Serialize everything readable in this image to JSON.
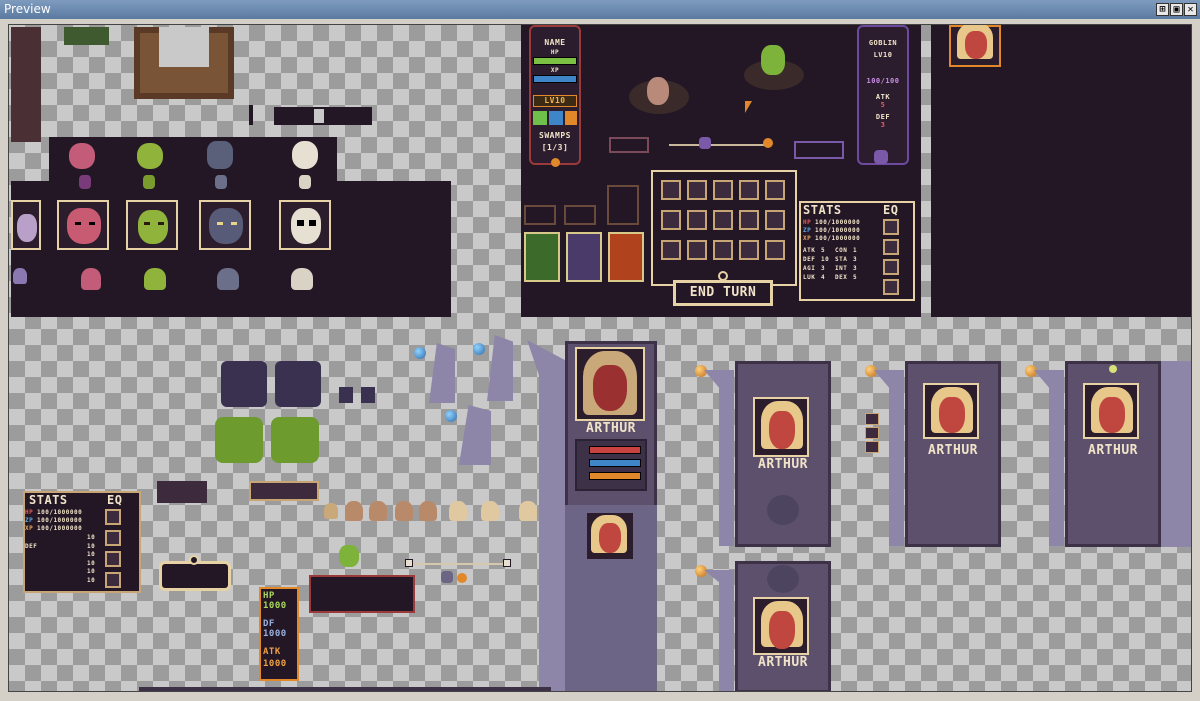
{
  "window": {
    "title": "Preview"
  },
  "topHud": {
    "name_label": "NAME",
    "hp_label": "HP",
    "xp_label": "XP",
    "level_label": "LV10",
    "location": "SWAMPS",
    "stage": "[1/3]",
    "enemy_name": "GOBLIN",
    "enemy_level": "LV10",
    "enemy_hp": "100/100",
    "enemy_atk_label": "ATK",
    "enemy_atk_value": "5",
    "enemy_def_label": "DEF",
    "enemy_def_value": "3",
    "end_turn": "END TURN"
  },
  "statsPanel": {
    "title": "STATS",
    "eq_title": "EQ",
    "hp": "HP",
    "hp_value": "100/1000000",
    "zp": "ZP",
    "zp_value": "100/1000000",
    "xp": "XP",
    "xp_value": "100/1000000",
    "rows": [
      {
        "k1": "ATK",
        "v1": "5",
        "k2": "CON",
        "v2": "1"
      },
      {
        "k1": "DEF",
        "v1": "10",
        "k2": "STA",
        "v2": "3"
      },
      {
        "k1": "AGI",
        "v1": "3",
        "k2": "INT",
        "v2": "3"
      },
      {
        "k1": "LUK",
        "v1": "4",
        "k2": "DEX",
        "v2": "5"
      }
    ]
  },
  "statsPanelSmall": {
    "title": "STATS",
    "eq_title": "EQ",
    "hp": "HP",
    "hp_value": "100/1000000",
    "zp": "ZP",
    "zp_value": "100/1000000",
    "xp": "XP",
    "xp_value": "100/1000000",
    "def_label": "DEF",
    "values": [
      "10",
      "10",
      "10",
      "10",
      "10",
      "10"
    ]
  },
  "hpBadges": {
    "hp_label": "HP",
    "hp_value": "1000",
    "df_label": "DF",
    "df_value": "1000",
    "atk_label": "ATK",
    "atk_value": "1000"
  },
  "heroCards": {
    "tall_card_name": "ARTHUR",
    "card1_name": "ARTHUR",
    "card2_name": "ARTHUR",
    "card3_name": "ARTHUR",
    "card4_name": "ARTHUR"
  },
  "colors": {
    "panel_dark": "#231725",
    "frame_tan": "#e7d2a6",
    "hp_red": "#c8433f",
    "xp_blue": "#3f86c8",
    "accent_orange": "#e0882a",
    "goblin_green": "#7db33b",
    "card_purple": "#5d506c"
  }
}
